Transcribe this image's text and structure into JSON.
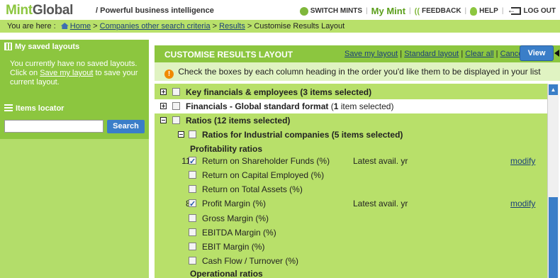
{
  "header": {
    "logo_mint": "Mint",
    "logo_global": "Global",
    "tagline": "/ Powerful business intelligence",
    "switch_mints": "SWITCH MINTS",
    "my_mint": "My Mint",
    "feedback": "FEEDBACK",
    "help": "HELP",
    "logout": "LOG OUT"
  },
  "breadcrumb": {
    "prefix": "You are here :",
    "home": "Home",
    "sep1": ">",
    "companies": "Companies other search criteria",
    "sep2": ">",
    "results": "Results",
    "sep3": ">",
    "current": "Customise Results Layout"
  },
  "sidebar": {
    "saved_title": "My saved layouts",
    "saved_text_1": "You currently have no saved layouts. Click on",
    "saved_link": "Save my layout",
    "saved_text_2": "to save your current layout.",
    "locator_title": "Items locator",
    "search_value": "",
    "search_button": "Search"
  },
  "main": {
    "title": "CUSTOMISE RESULTS LAYOUT",
    "links": [
      "Save my layout",
      "Standard layout",
      "Clear all",
      "Cancel"
    ],
    "link_sep": "|",
    "view_button": "View",
    "info": "Check the boxes by each column heading in the order you'd like them to be displayed in your list",
    "warn_glyph": "!"
  },
  "list": {
    "key_financials": "Key financials & employees",
    "key_financials_sel": "(3 items selected)",
    "financials_global": "Financials - Global standard format",
    "financials_global_sel_pre": "(",
    "financials_global_sel_num": "1",
    "financials_global_sel_post": "item selected)",
    "ratios": "Ratios",
    "ratios_sel": "(12 items selected)",
    "ratios_industrial": "Ratios for Industrial companies",
    "ratios_industrial_sel": "(5 items selected)",
    "profitability": "Profitability ratios",
    "items": [
      {
        "num": "11.",
        "label": "Return on Shareholder Funds (%)",
        "checked": true,
        "period": "Latest avail. yr",
        "modify": "modify"
      },
      {
        "num": "",
        "label": "Return on Capital Employed (%)",
        "checked": false,
        "period": "",
        "modify": ""
      },
      {
        "num": "",
        "label": "Return on Total Assets (%)",
        "checked": false,
        "period": "",
        "modify": ""
      },
      {
        "num": "8.",
        "label": "Profit Margin (%)",
        "checked": true,
        "period": "Latest avail. yr",
        "modify": "modify"
      },
      {
        "num": "",
        "label": "Gross Margin (%)",
        "checked": false,
        "period": "",
        "modify": ""
      },
      {
        "num": "",
        "label": "EBITDA Margin (%)",
        "checked": false,
        "period": "",
        "modify": ""
      },
      {
        "num": "",
        "label": "EBIT Margin (%)",
        "checked": false,
        "period": "",
        "modify": ""
      },
      {
        "num": "",
        "label": "Cash Flow / Turnover (%)",
        "checked": false,
        "period": "",
        "modify": ""
      }
    ],
    "operational": "Operational ratios"
  },
  "colors": {
    "brand_green": "#8cc63f",
    "light_green": "#b8e06a",
    "pale_green": "#e0f3c2",
    "button_blue": "#3a7ec8",
    "warn_orange": "#f08a00"
  }
}
